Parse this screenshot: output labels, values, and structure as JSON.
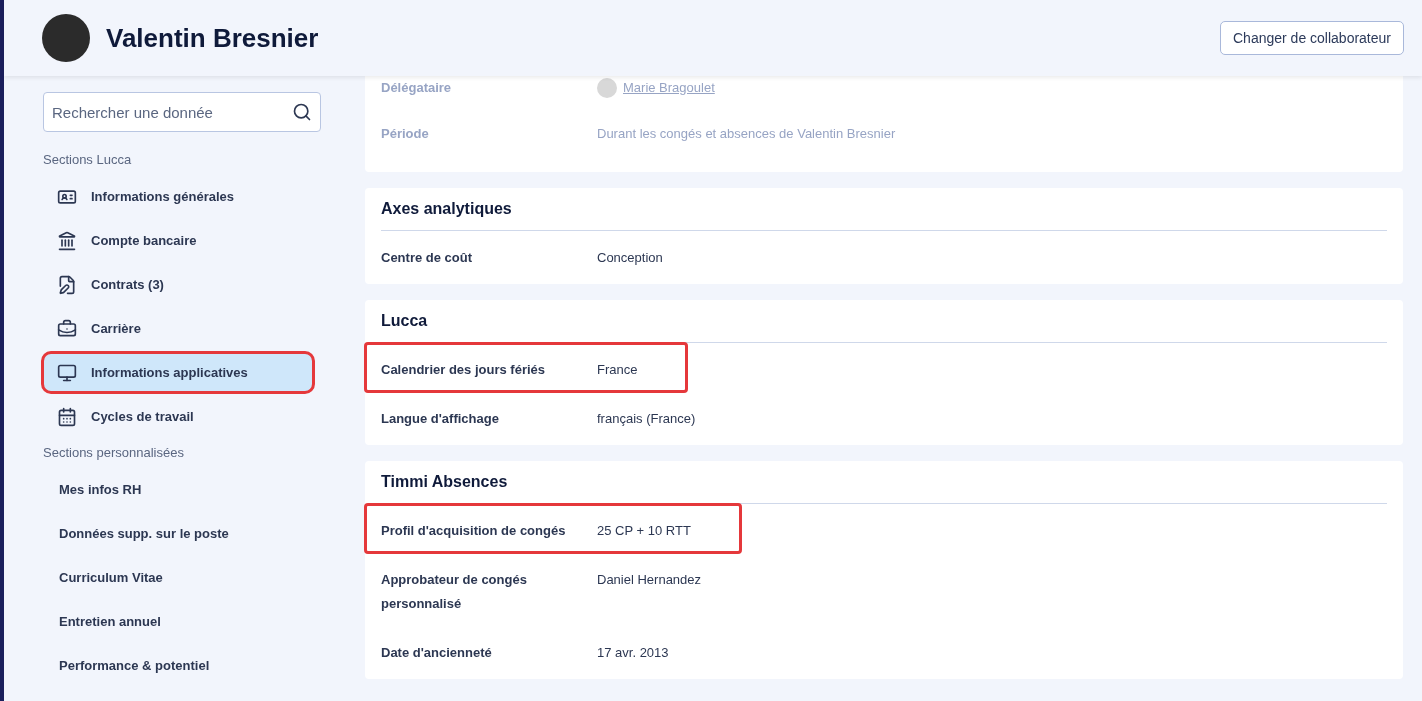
{
  "header": {
    "name": "Valentin Bresnier",
    "button": "Changer de collaborateur"
  },
  "sidebar": {
    "search": {
      "placeholder": "Rechercher une donnée"
    },
    "sections": [
      {
        "title": "Sections Lucca",
        "items": [
          {
            "label": "Informations générales",
            "selected": false,
            "highlighted": false
          },
          {
            "label": "Compte bancaire",
            "selected": false,
            "highlighted": false
          },
          {
            "label": "Contrats (3)",
            "selected": false,
            "highlighted": false
          },
          {
            "label": "Carrière",
            "selected": false,
            "highlighted": false
          },
          {
            "label": "Informations applicatives",
            "selected": true,
            "highlighted": true
          },
          {
            "label": "Cycles de travail",
            "selected": false,
            "highlighted": false
          }
        ]
      },
      {
        "title": "Sections personnalisées",
        "items": [
          {
            "label": "Mes infos RH",
            "selected": false,
            "highlighted": false
          },
          {
            "label": "Données supp. sur le poste",
            "selected": false,
            "highlighted": false
          },
          {
            "label": "Curriculum Vitae",
            "selected": false,
            "highlighted": false
          },
          {
            "label": "Entretien annuel",
            "selected": false,
            "highlighted": false
          },
          {
            "label": "Performance & potentiel",
            "selected": false,
            "highlighted": false
          }
        ]
      }
    ]
  },
  "cards": [
    {
      "faded": true,
      "rows": [
        {
          "kind": "person",
          "label": "Délégataire",
          "value": "Marie Bragoulet",
          "highlighted": false
        },
        {
          "kind": "text",
          "label": "Période",
          "value": "Durant les congés et absences de Valentin Bresnier",
          "highlighted": false
        }
      ]
    },
    {
      "title": "Axes analytiques",
      "faded": false,
      "rows": [
        {
          "kind": "text",
          "label": "Centre de coût",
          "value": "Conception",
          "highlighted": false
        }
      ]
    },
    {
      "title": "Lucca",
      "faded": false,
      "rows": [
        {
          "kind": "text",
          "label": "Calendrier des jours fériés",
          "value": "France",
          "highlighted": true
        },
        {
          "kind": "text",
          "label": "Langue d'affichage",
          "value": "français (France)",
          "highlighted": false
        }
      ]
    },
    {
      "title": "Timmi Absences",
      "faded": false,
      "rows": [
        {
          "kind": "text",
          "label": "Profil d'acquisition de congés",
          "value": "25 CP + 10 RTT",
          "highlighted": true
        },
        {
          "kind": "text",
          "label": "Approbateur de congés personnalisé",
          "value": "Daniel Hernandez",
          "highlighted": false
        },
        {
          "kind": "text",
          "label": "Date d'ancienneté",
          "value": "17 avr. 2013",
          "highlighted": false
        }
      ]
    }
  ]
}
